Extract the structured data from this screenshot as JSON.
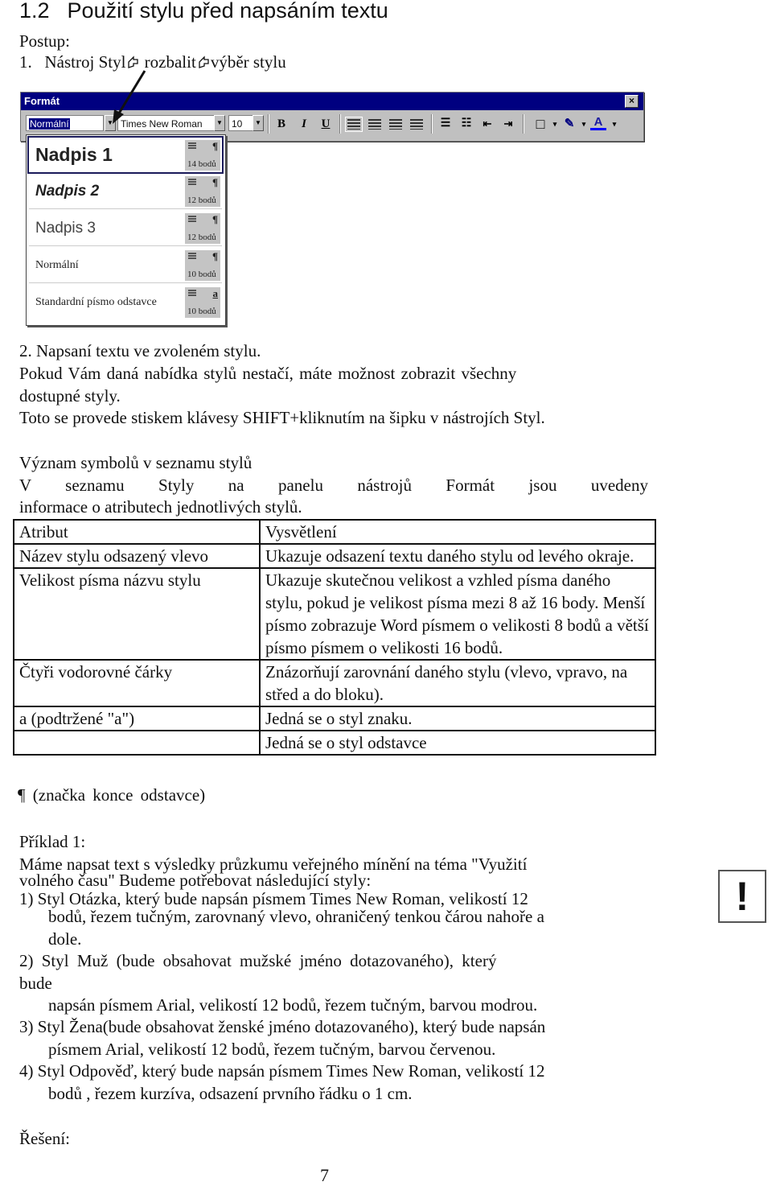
{
  "heading": {
    "number": "1.2",
    "title": "Použití stylu před napsáním textu"
  },
  "procedure_label": "Postup:",
  "step1": {
    "number": "1.",
    "part1": "Nástroj Styl",
    "part2": " rozbalit",
    "part3": "výběr stylu",
    "separator_icon": "cursor-pointer-icon"
  },
  "toolbar": {
    "window_title": "Formát",
    "close_label": "×",
    "style_value": "Normální",
    "font_value": "Times New Roman",
    "size_value": "10",
    "bold_label": "B",
    "italic_label": "I",
    "underline_label": "U",
    "buttons": [
      "align-left",
      "align-center",
      "align-right",
      "justify",
      "numbering",
      "bullets",
      "decrease-indent",
      "increase-indent",
      "border",
      "highlight",
      "font-color"
    ],
    "colors": {
      "title_bar": "#000080",
      "face": "#c0c0c0",
      "highlight": "#000080",
      "font_color_underline": "#0000ff"
    }
  },
  "style_list": [
    {
      "name": "Nadpis 1",
      "size": "14 bodů",
      "mark": "¶",
      "active": true
    },
    {
      "name": "Nadpis 2",
      "size": "12 bodů",
      "mark": "¶"
    },
    {
      "name": "Nadpis 3",
      "size": "12 bodů",
      "mark": "¶"
    },
    {
      "name": "Normální",
      "size": "10 bodů",
      "mark": "¶"
    },
    {
      "name": "Standardní písmo odstavce",
      "size": "10 bodů",
      "mark": "a"
    }
  ],
  "step2": "2.   Napsaní textu ve zvoleném stylu.",
  "para1_line1": "Pokud Vám daná nabídka stylů nestačí,  máte  možnost  zobrazit  všechny",
  "para1_line2": "dostupné styly.",
  "para2": "Toto se provede stiskem klávesy SHIFT+kliknutím na šipku v nástrojích Styl.",
  "symbols_heading": "Význam symbolů v seznamu stylů",
  "symbols_line1": "V seznamu Styly na panelu nástrojů Formát jsou uvedeny",
  "symbols_line2": "informace o atributech jednotlivých stylů.",
  "table": {
    "headers": [
      "Atribut",
      "Vysvětlení"
    ],
    "rows": [
      [
        "Název stylu odsazený vlevo",
        "Ukazuje odsazení textu daného stylu od levého okraje."
      ],
      [
        "Velikost písma názvu stylu",
        "Ukazuje skutečnou velikost a vzhled písma daného stylu, pokud je velikost písma mezi 8 až 16 body. Menší písmo zobrazuje Word písmem o velikosti 8 bodů a větší písmo písmem o velikosti 16 bodů."
      ],
      [
        "Čtyři vodorovné čárky",
        "Znázorňují zarovnání daného stylu (vlevo, vpravo, na střed a do bloku)."
      ],
      [
        "a (podtržené \"a\")",
        "Jedná se o styl znaku."
      ],
      [
        "",
        "Jedná se o styl odstavce"
      ]
    ],
    "pilcrow_note": "¶ (značka konce odstavce)"
  },
  "example": {
    "title": "Příklad 1:",
    "intro_line1": "Máme napsat text s výsledky průzkumu veřejného mínění na téma \"Využití",
    "intro_line2": "volného času\" Budeme potřebovat následující styly:",
    "items": [
      {
        "lines": [
          "1)   Styl Otázka, který bude napsán písmem Times New Roman, velikostí 12",
          "bodů, řezem tučným, zarovnaný vlevo, ohraničený tenkou čárou nahoře a",
          "dole."
        ]
      },
      {
        "lines": [
          "2)  Styl  Muž  (bude   obsahovat   mužské   jméno  dotazovaného),   který",
          "bude",
          "napsán písmem Arial, velikostí    12 bodů, řezem tučným, barvou modrou."
        ]
      },
      {
        "lines": [
          "3)   Styl Žena(bude obsahovat ženské jméno dotazovaného), který bude napsán",
          "písmem Arial, velikostí    12 bodů, řezem tučným, barvou červenou."
        ]
      },
      {
        "lines": [
          "4)   Styl Odpověď, který bude napsán písmem Times New Roman, velikostí 12",
          "bodů , řezem kurzíva, odsazení prvního řádku o 1 cm."
        ]
      }
    ],
    "warning_icon": "!"
  },
  "solution_label": "Řešení:",
  "page_number": "7"
}
